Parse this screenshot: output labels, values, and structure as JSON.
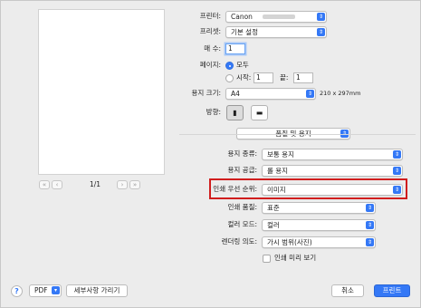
{
  "preview": {
    "page_indicator": "1/1",
    "first_label": "«",
    "prev_label": "‹",
    "next_label": "›",
    "last_label": "»"
  },
  "printer": {
    "label": "프린터:",
    "value": "Canon"
  },
  "preset": {
    "label": "프리셋:",
    "value": "기본 설정"
  },
  "copies": {
    "label": "매 수:",
    "value": "1"
  },
  "pages": {
    "label": "페이지:",
    "all_label": "모두",
    "from_label": "시작:",
    "from_value": "1",
    "to_label": "끝:",
    "to_value": "1"
  },
  "paper_size": {
    "label": "용지 크기:",
    "value": "A4",
    "dimensions": "210 x 297mm"
  },
  "orientation": {
    "label": "방향:"
  },
  "section_popup": {
    "value": "품질 및 용지"
  },
  "media_type": {
    "label": "용지 종류:",
    "value": "보통 용지"
  },
  "paper_source": {
    "label": "용지 공급:",
    "value": "롤 용지"
  },
  "print_priority": {
    "label": "인쇄 우선 순위:",
    "value": "이미지"
  },
  "print_quality": {
    "label": "인쇄 품질:",
    "value": "표준"
  },
  "color_mode": {
    "label": "컬러 모드:",
    "value": "컬러"
  },
  "rendering_intent": {
    "label": "렌더링 의도:",
    "value": "가시 범위(사진)"
  },
  "print_preview": {
    "label": "인쇄 미리 보기"
  },
  "footer": {
    "help_label": "?",
    "pdf_label": "PDF",
    "hide_details_label": "세부사항 가리기",
    "cancel_label": "취소",
    "print_label": "프린트"
  },
  "colors": {
    "accent": "#3478f6",
    "highlight": "#d01d1d"
  }
}
